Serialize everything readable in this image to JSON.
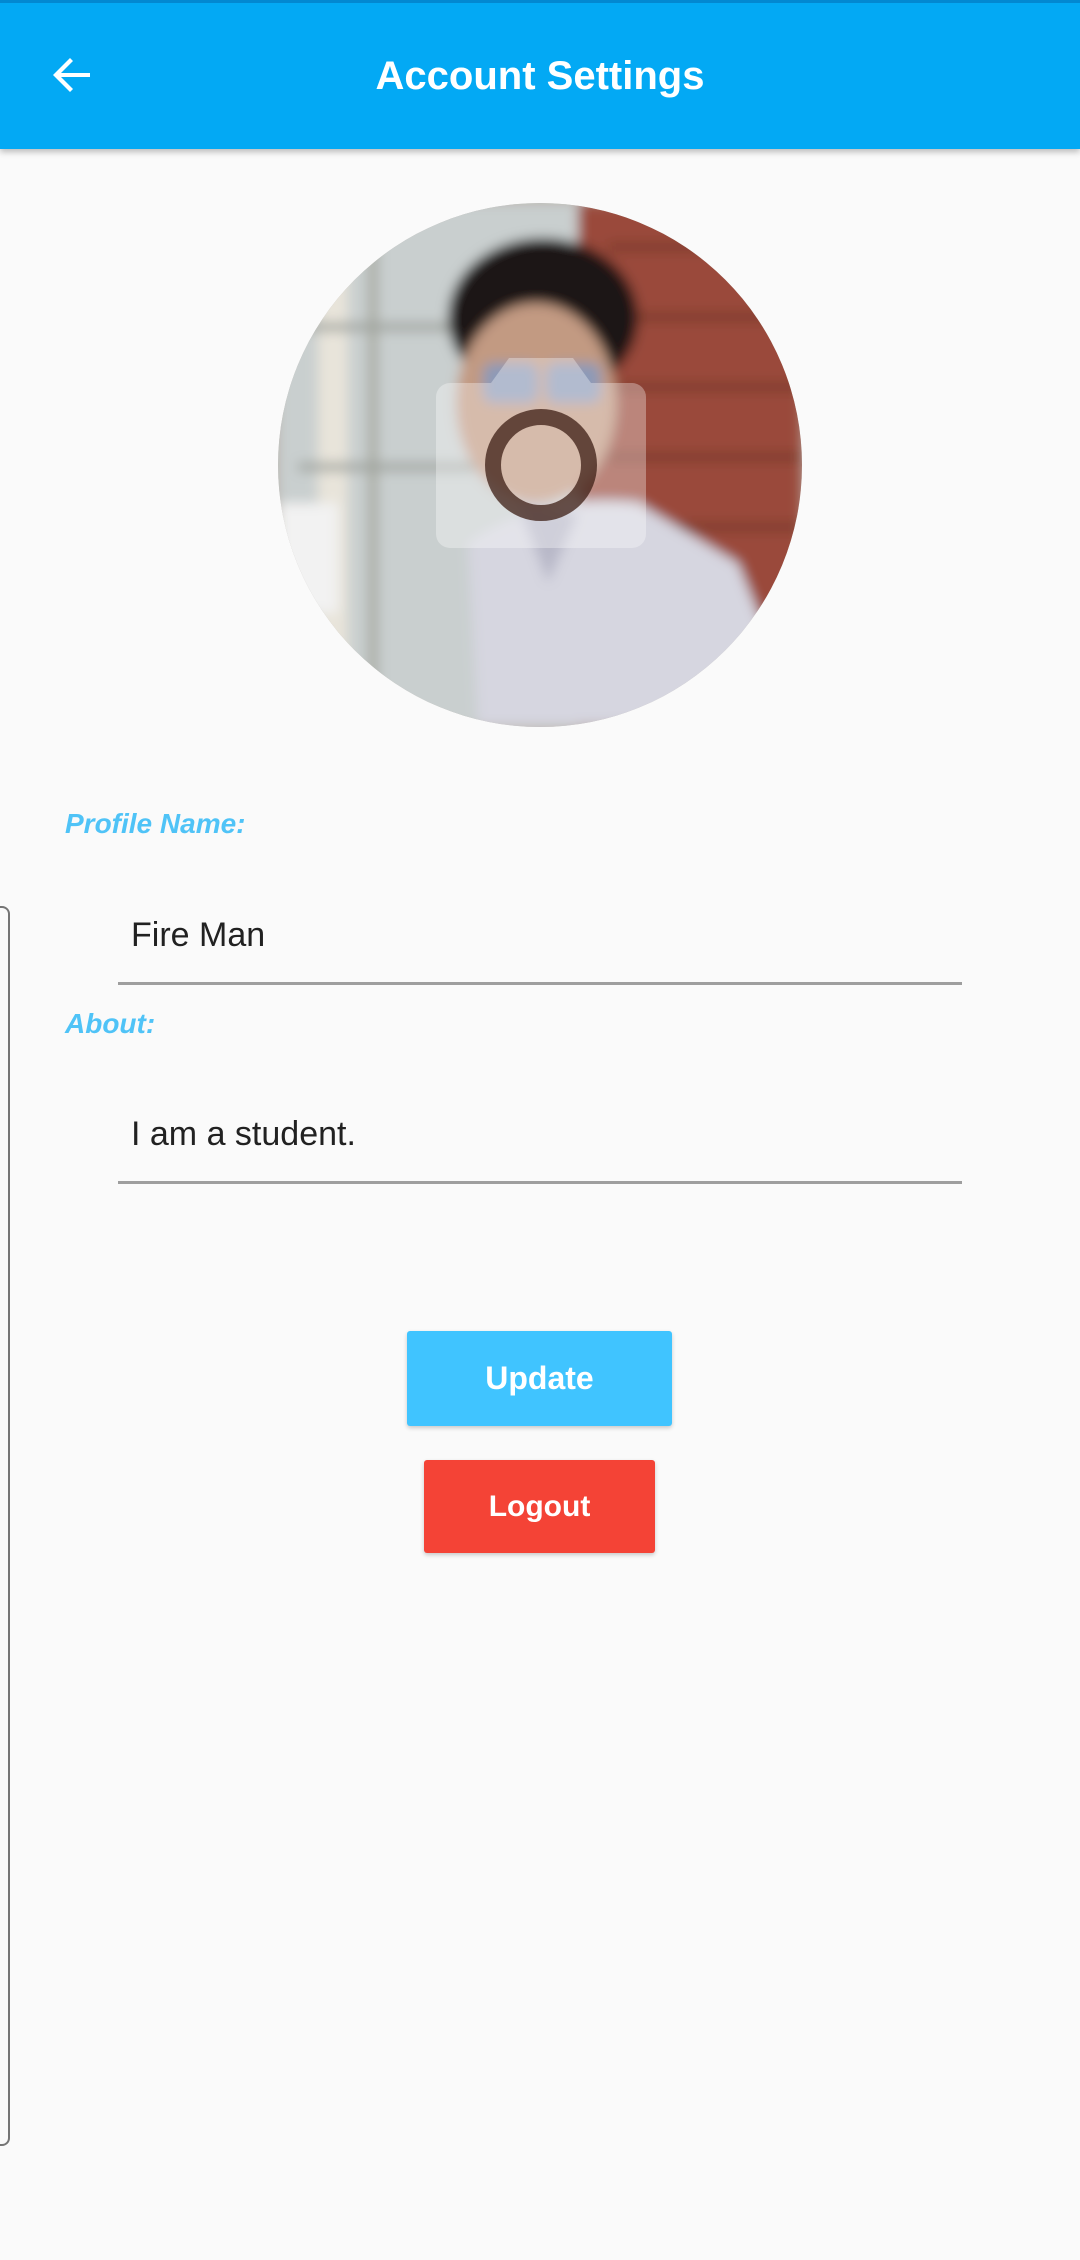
{
  "header": {
    "title": "Account Settings",
    "back_icon": "arrow-left-icon",
    "background_color": "#03a9f4"
  },
  "avatar": {
    "overlay_icon": "camera-icon"
  },
  "form": {
    "profile_name_label": "Profile Name:",
    "profile_name_value": "Fire Man",
    "about_label": "About:",
    "about_value": "I am a student.",
    "label_color": "#4fc3f7"
  },
  "actions": {
    "update_label": "Update",
    "update_color": "#40c4ff",
    "logout_label": "Logout",
    "logout_color": "#f44336"
  }
}
